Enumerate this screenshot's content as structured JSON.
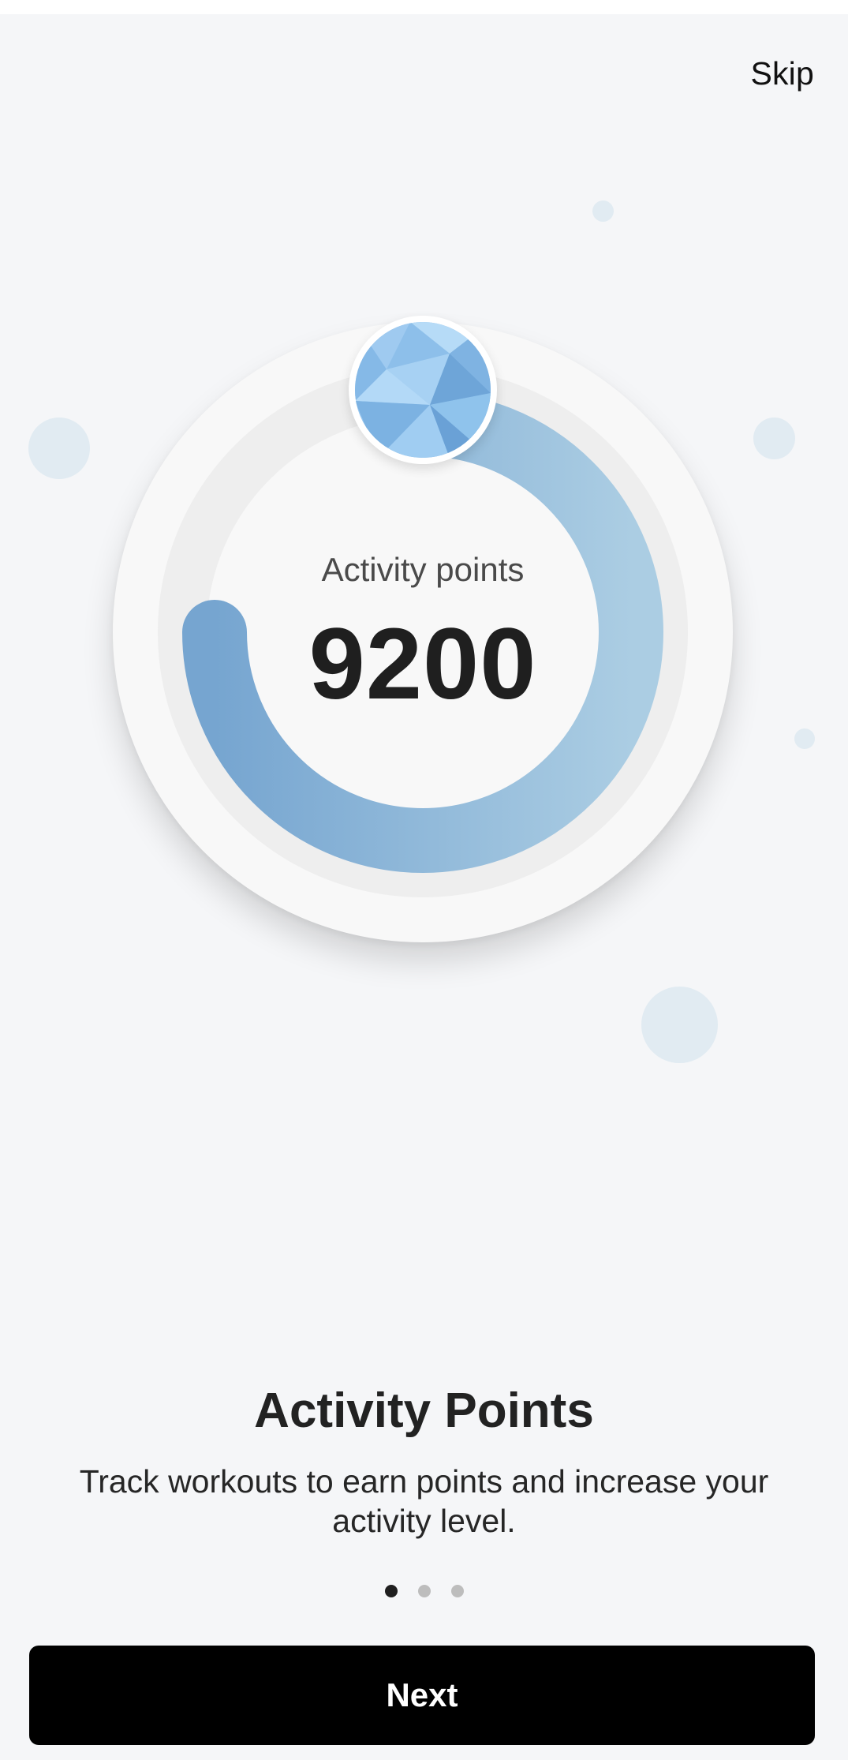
{
  "header": {
    "skip_label": "Skip"
  },
  "progress_ring": {
    "label": "Activity points",
    "value": "9200",
    "progress_fraction": 0.75,
    "colors": {
      "track": "#eeeeee",
      "gradient_start": "#76a5d0",
      "gradient_end": "#abcde3",
      "face": "#f8f8f8"
    },
    "badge_icon": "diamond-gem-icon"
  },
  "onboarding": {
    "title": "Activity Points",
    "description": "Track workouts to earn points and increase your activity level.",
    "page_indicator": {
      "current": 1,
      "total": 3
    }
  },
  "footer": {
    "next_label": "Next"
  },
  "colors": {
    "background": "#f5f6f8",
    "bubble": "#dde9f1",
    "button": "#000000",
    "button_text": "#ffffff"
  }
}
